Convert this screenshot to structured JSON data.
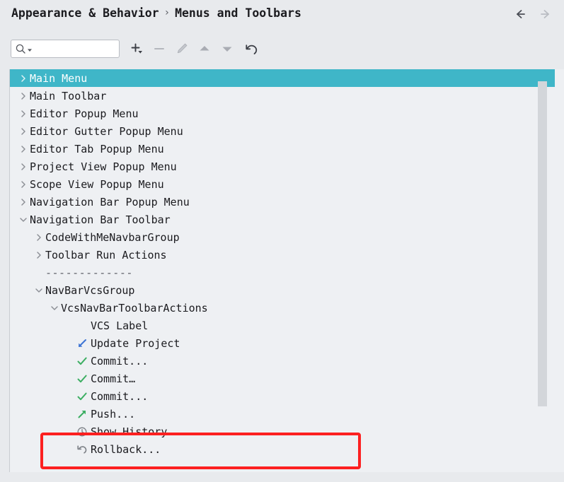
{
  "header": {
    "breadcrumb": [
      "Appearance & Behavior",
      "Menus and Toolbars"
    ],
    "separator": "›",
    "back_icon": "arrow-left-icon",
    "forward_icon": "arrow-right-icon",
    "back_enabled": true,
    "forward_enabled": false
  },
  "toolbar": {
    "search": {
      "value": "",
      "placeholder": "",
      "icon": "search-icon",
      "dropdown_icon": "chevron-down-icon"
    },
    "buttons": [
      {
        "name": "add-button",
        "icon": "plus-with-dropdown-icon",
        "enabled": true
      },
      {
        "name": "remove-button",
        "icon": "minus-icon",
        "enabled": false
      },
      {
        "name": "edit-button",
        "icon": "pencil-icon",
        "enabled": false
      },
      {
        "name": "move-up-button",
        "icon": "triangle-up-icon",
        "enabled": true
      },
      {
        "name": "move-down-button",
        "icon": "triangle-down-icon",
        "enabled": true
      },
      {
        "name": "restore-defaults-button",
        "icon": "revert-arrow-icon",
        "enabled": true
      }
    ]
  },
  "colors": {
    "selection": "#3fb6c8",
    "panel_bg": "#eef0f3",
    "window_bg": "#e8eaed",
    "annotation": "#fc2020",
    "commit_green": "#3cae62",
    "update_blue": "#3d74d4",
    "push_green": "#3cae62",
    "history_gray": "#7d8187",
    "rollback_gray": "#7d8187"
  },
  "tree": {
    "rows": [
      {
        "label": "Main Menu",
        "indent": 0,
        "twisty": "collapsed",
        "icon": null,
        "selected": true
      },
      {
        "label": "Main Toolbar",
        "indent": 0,
        "twisty": "collapsed",
        "icon": null,
        "selected": false
      },
      {
        "label": "Editor Popup Menu",
        "indent": 0,
        "twisty": "collapsed",
        "icon": null,
        "selected": false
      },
      {
        "label": "Editor Gutter Popup Menu",
        "indent": 0,
        "twisty": "collapsed",
        "icon": null,
        "selected": false
      },
      {
        "label": "Editor Tab Popup Menu",
        "indent": 0,
        "twisty": "collapsed",
        "icon": null,
        "selected": false
      },
      {
        "label": "Project View Popup Menu",
        "indent": 0,
        "twisty": "collapsed",
        "icon": null,
        "selected": false
      },
      {
        "label": "Scope View Popup Menu",
        "indent": 0,
        "twisty": "collapsed",
        "icon": null,
        "selected": false
      },
      {
        "label": "Navigation Bar Popup Menu",
        "indent": 0,
        "twisty": "collapsed",
        "icon": null,
        "selected": false
      },
      {
        "label": "Navigation Bar Toolbar",
        "indent": 0,
        "twisty": "expanded",
        "icon": null,
        "selected": false
      },
      {
        "label": "CodeWithMeNavbarGroup",
        "indent": 1,
        "twisty": "collapsed",
        "icon": null,
        "selected": false
      },
      {
        "label": "Toolbar Run Actions",
        "indent": 1,
        "twisty": "collapsed",
        "icon": null,
        "selected": false
      },
      {
        "label": "-------------",
        "indent": 1,
        "twisty": "none",
        "icon": null,
        "selected": false,
        "separator": true
      },
      {
        "label": "NavBarVcsGroup",
        "indent": 1,
        "twisty": "expanded",
        "icon": null,
        "selected": false
      },
      {
        "label": "VcsNavBarToolbarActions",
        "indent": 2,
        "twisty": "expanded",
        "icon": null,
        "selected": false
      },
      {
        "label": "VCS Label",
        "indent": 3,
        "twisty": "none",
        "icon": null,
        "selected": false
      },
      {
        "label": "Update Project",
        "indent": 3,
        "twisty": "none",
        "icon": "update-icon",
        "selected": false
      },
      {
        "label": "Commit...",
        "indent": 3,
        "twisty": "none",
        "icon": "commit-icon",
        "selected": false
      },
      {
        "label": "Commit…",
        "indent": 3,
        "twisty": "none",
        "icon": "commit-icon",
        "selected": false
      },
      {
        "label": "Commit...",
        "indent": 3,
        "twisty": "none",
        "icon": "commit-icon",
        "selected": false
      },
      {
        "label": "Push...",
        "indent": 3,
        "twisty": "none",
        "icon": "push-icon",
        "selected": false
      },
      {
        "label": "Show History",
        "indent": 3,
        "twisty": "none",
        "icon": "history-icon",
        "selected": false
      },
      {
        "label": "Rollback...",
        "indent": 3,
        "twisty": "none",
        "icon": "rollback-icon",
        "selected": false
      }
    ]
  },
  "annotation": {
    "target_label": "Rollback..."
  }
}
